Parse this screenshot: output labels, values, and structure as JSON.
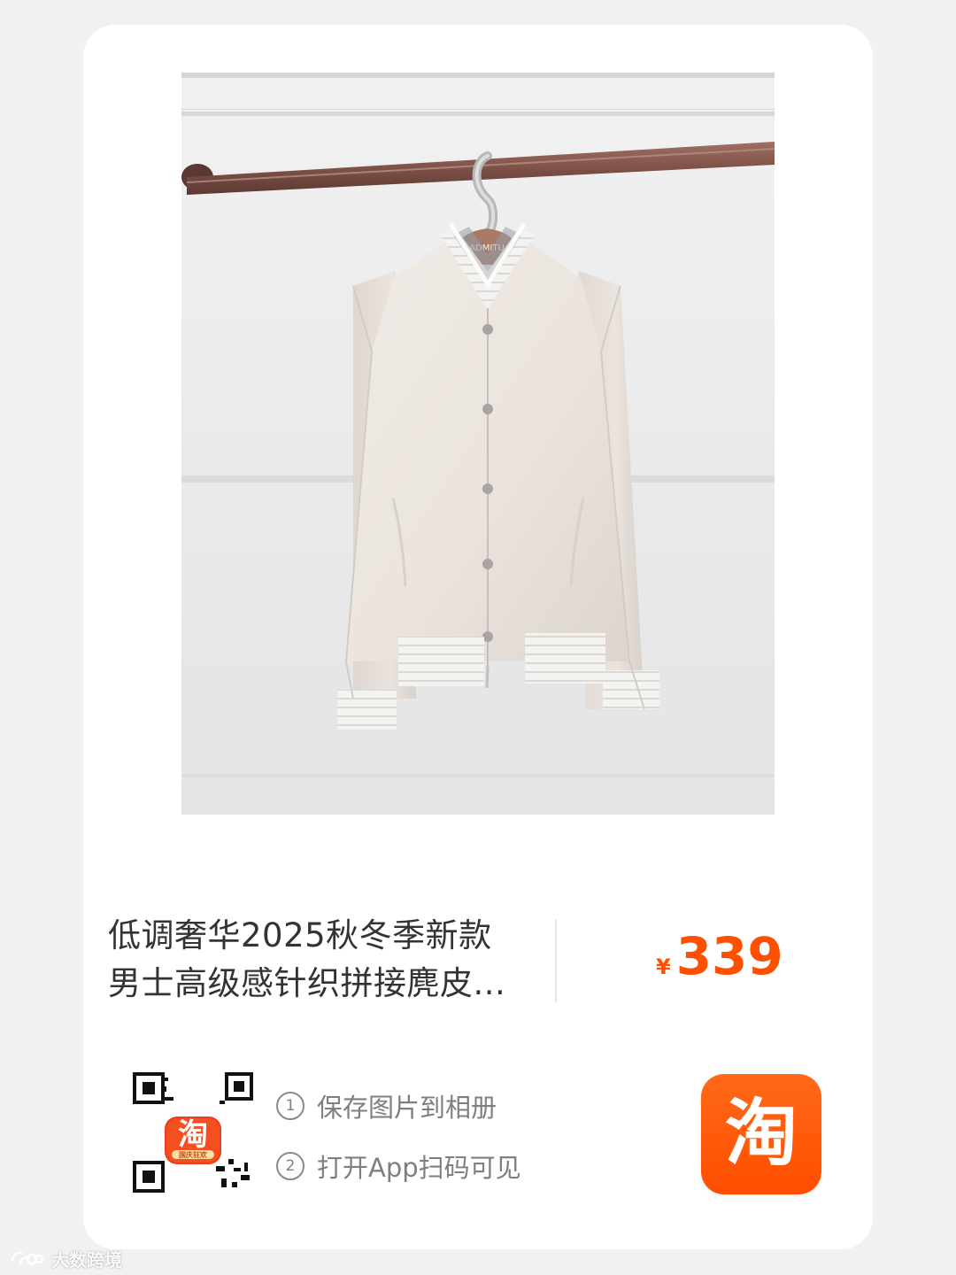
{
  "product": {
    "title_lines": [
      "低调奢华2025秋冬季新款",
      "男士高级感针织拼接麂皮..."
    ],
    "currency_symbol": "¥",
    "price": "339",
    "hanger_brand": "ADMITU"
  },
  "instructions": {
    "steps": [
      {
        "index": "1",
        "label": "保存图片到相册"
      },
      {
        "index": "2",
        "label": "打开App扫码可见"
      }
    ]
  },
  "qr_badge": {
    "label": "淘",
    "sub_label": "国庆狂欢"
  },
  "app_icon": {
    "label": "淘"
  },
  "watermark": {
    "text": "大数跨境",
    "icon": "brand-mark-icon"
  },
  "colors": {
    "price": "#ff5000",
    "app_icon": "#ff5a00",
    "card_background": "#ffffff",
    "page_background": "#f1f1f1"
  }
}
